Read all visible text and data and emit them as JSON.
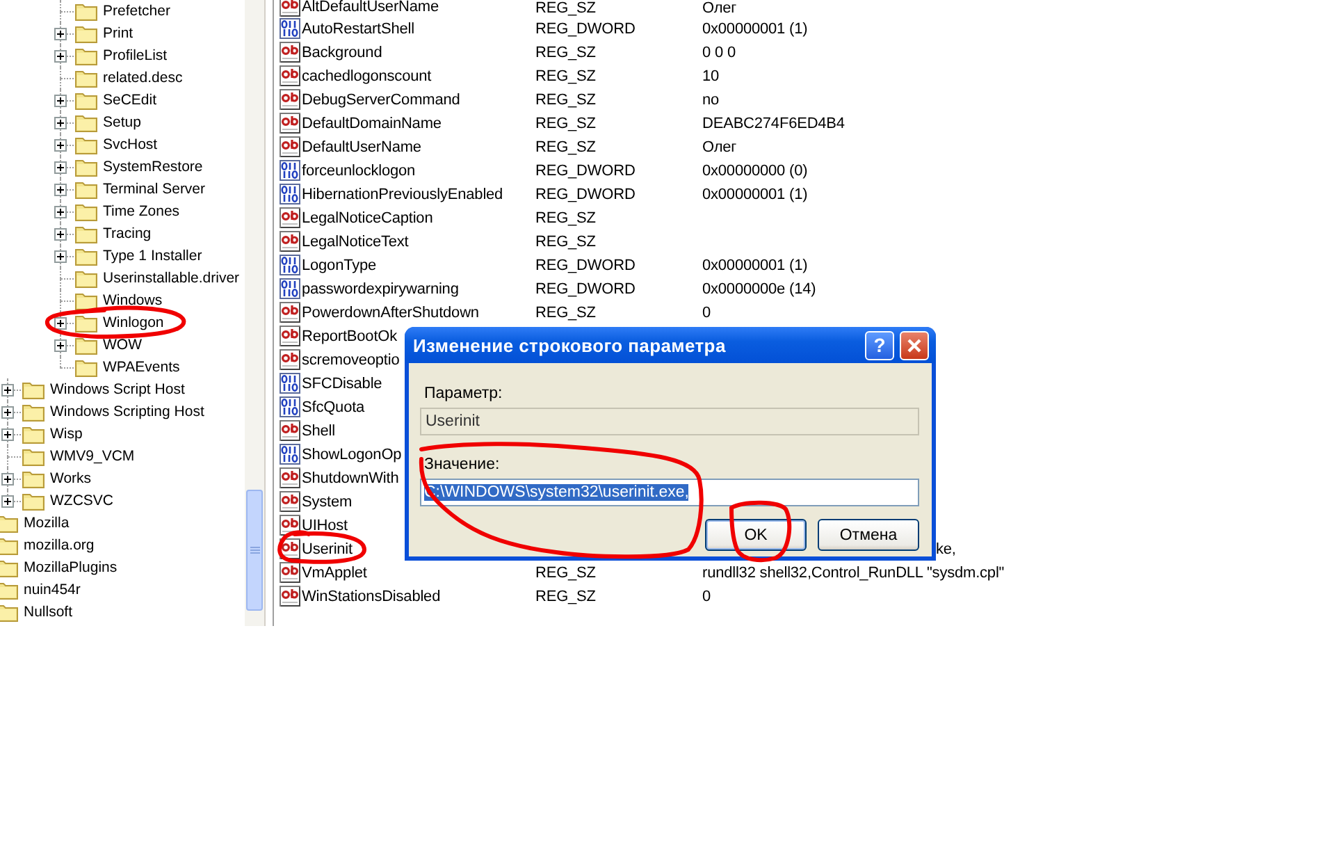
{
  "tree": {
    "items": [
      {
        "children": [
          {
            "children": [
              {
                "children": [
                  {
                    "label": "Prefetcher",
                    "expandable": false
                  },
                  {
                    "label": "Print",
                    "expandable": true
                  },
                  {
                    "label": "ProfileList",
                    "expandable": true
                  },
                  {
                    "label": "related.desc",
                    "expandable": false
                  },
                  {
                    "label": "SeCEdit",
                    "expandable": true
                  },
                  {
                    "label": "Setup",
                    "expandable": true
                  },
                  {
                    "label": "SvcHost",
                    "expandable": true
                  },
                  {
                    "label": "SystemRestore",
                    "expandable": true
                  },
                  {
                    "label": "Terminal Server",
                    "expandable": true
                  },
                  {
                    "label": "Time Zones",
                    "expandable": true
                  },
                  {
                    "label": "Tracing",
                    "expandable": true
                  },
                  {
                    "label": "Type 1 Installer",
                    "expandable": true
                  },
                  {
                    "label": "Userinstallable.driver",
                    "expandable": false
                  },
                  {
                    "label": "Windows",
                    "expandable": false
                  },
                  {
                    "label": "Winlogon",
                    "expandable": true
                  },
                  {
                    "label": "WOW",
                    "expandable": true
                  },
                  {
                    "label": "WPAEvents",
                    "expandable": false
                  }
                ]
              }
            ]
          },
          {
            "label": "Windows Script Host",
            "expandable": true
          },
          {
            "label": "Windows Scripting Host",
            "expandable": true
          },
          {
            "label": "Wisp",
            "expandable": true
          },
          {
            "label": "WMV9_VCM",
            "expandable": false
          },
          {
            "label": "Works",
            "expandable": true
          },
          {
            "label": "WZCSVC",
            "expandable": true
          }
        ]
      },
      {
        "label": "Mozilla"
      },
      {
        "label": "mozilla.org"
      },
      {
        "label": "MozillaPlugins"
      },
      {
        "label": "nuin454r"
      },
      {
        "label": "Nullsoft"
      }
    ]
  },
  "values": [
    {
      "kind": "string",
      "name": "AltDefaultUserName",
      "type": "REG_SZ",
      "data": "Олег"
    },
    {
      "kind": "dword",
      "name": "AutoRestartShell",
      "type": "REG_DWORD",
      "data": "0x00000001 (1)"
    },
    {
      "kind": "string",
      "name": "Background",
      "type": "REG_SZ",
      "data": "0 0 0"
    },
    {
      "kind": "string",
      "name": "cachedlogonscount",
      "type": "REG_SZ",
      "data": "10"
    },
    {
      "kind": "string",
      "name": "DebugServerCommand",
      "type": "REG_SZ",
      "data": "no"
    },
    {
      "kind": "string",
      "name": "DefaultDomainName",
      "type": "REG_SZ",
      "data": "DEABC274F6ED4B4"
    },
    {
      "kind": "string",
      "name": "DefaultUserName",
      "type": "REG_SZ",
      "data": "Олег"
    },
    {
      "kind": "dword",
      "name": "forceunlocklogon",
      "type": "REG_DWORD",
      "data": "0x00000000 (0)"
    },
    {
      "kind": "dword",
      "name": "HibernationPreviouslyEnabled",
      "type": "REG_DWORD",
      "data": "0x00000001 (1)"
    },
    {
      "kind": "string",
      "name": "LegalNoticeCaption",
      "type": "REG_SZ"
    },
    {
      "kind": "string",
      "name": "LegalNoticeText",
      "type": "REG_SZ"
    },
    {
      "kind": "dword",
      "name": "LogonType",
      "type": "REG_DWORD",
      "data": "0x00000001 (1)"
    },
    {
      "kind": "dword",
      "name": "passwordexpirywarning",
      "type": "REG_DWORD",
      "data": "0x0000000e (14)"
    },
    {
      "kind": "string",
      "name": "PowerdownAfterShutdown",
      "type": "REG_SZ",
      "data": "0"
    },
    {
      "kind": "string",
      "name": "ReportBootOk"
    },
    {
      "kind": "string",
      "name": "scremoveoptio"
    },
    {
      "kind": "dword",
      "name": "SFCDisable"
    },
    {
      "kind": "dword",
      "name": "SfcQuota"
    },
    {
      "kind": "string",
      "name": "Shell"
    },
    {
      "kind": "dword",
      "name": "ShowLogonOp"
    },
    {
      "kind": "string",
      "name": "ShutdownWith"
    },
    {
      "kind": "string",
      "name": "System"
    },
    {
      "kind": "string",
      "name": "UIHost"
    },
    {
      "kind": "string",
      "name": "Userinit",
      "data": "ke,",
      "data_cut": true
    },
    {
      "kind": "string",
      "name": "VmApplet",
      "type": "REG_SZ",
      "data": "rundll32 shell32,Control_RunDLL \"sysdm.cpl\""
    },
    {
      "kind": "string",
      "name": "WinStationsDisabled",
      "type": "REG_SZ",
      "data": "0"
    }
  ],
  "dialog": {
    "title": "Изменение строкового параметра",
    "help": "?",
    "parameter_label": "Параметр:",
    "parameter_value": "Userinit",
    "value_label": "Значение:",
    "value": "C:\\WINDOWS\\system32\\userinit.exe,",
    "value_selected": true,
    "buttons": [
      {
        "label": "OK",
        "default": true
      },
      {
        "label": "Отмена",
        "default": false
      }
    ]
  }
}
